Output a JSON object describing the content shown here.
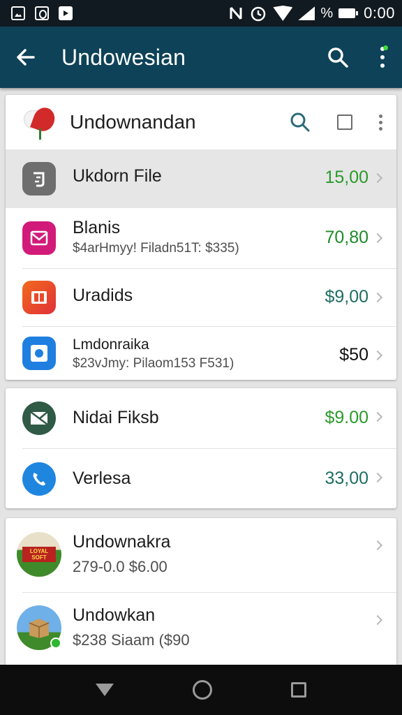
{
  "colors": {
    "app_bar": "#0e4258",
    "status_bar": "#111a20",
    "price_green": "#2a9a2a",
    "price_teal": "#1f6e62",
    "price_black": "#111111"
  },
  "status_bar": {
    "icons": [
      "gallery-icon",
      "circle-icon",
      "video-icon"
    ],
    "right_icons": [
      "nfc-icon",
      "alarm-icon",
      "wifi-icon",
      "signal-icon",
      "battery-icon"
    ],
    "percent": "%",
    "time": "0:00"
  },
  "app_bar": {
    "title": "Undowesian",
    "back_icon": "arrow-left-icon",
    "search_icon": "search-icon",
    "menu_icon": "more-vert-icon"
  },
  "card1": {
    "title": "Undownandan",
    "items": [
      {
        "title": "Ukdorn File",
        "subtitle": "",
        "price": "15,00",
        "icon": "file-icon"
      },
      {
        "title": "Blanis",
        "subtitle": "$4arHmyy! Filadn51T: $335)",
        "price": "70,80",
        "icon": "mail-icon"
      },
      {
        "title": "Uradids",
        "subtitle": "",
        "price": "$9,00",
        "icon": "columns-icon"
      },
      {
        "title": "Lmdonraika",
        "subtitle": "$23vJmy: Pilaom153 F531)",
        "price": "$50",
        "icon": "target-icon"
      }
    ]
  },
  "card2": {
    "items": [
      {
        "title": "Nidai Fiksb",
        "price": "$9.00",
        "icon": "envelope-icon"
      },
      {
        "title": "Verlesa",
        "price": "33,00",
        "icon": "phone-icon"
      }
    ]
  },
  "card3": {
    "items": [
      {
        "title": "Undownakra",
        "subtitle": "279-0.0 $6.00",
        "icon_text": "LOYAL SOFT",
        "icon": "store-icon"
      },
      {
        "title": "Undowkan",
        "subtitle": "$238 Siaam ($90",
        "icon": "box-icon"
      }
    ]
  },
  "nav": {
    "back": "nav-back-icon",
    "home": "nav-home-icon",
    "recent": "nav-recent-icon"
  }
}
